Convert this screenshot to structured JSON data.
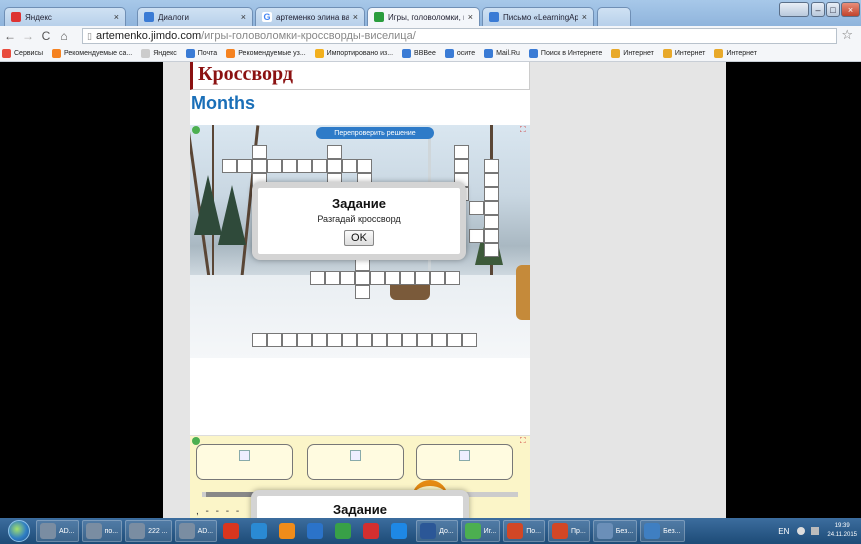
{
  "tabs": [
    {
      "label": "Яндекс",
      "icon": "yandex-icon",
      "color": "#d33"
    },
    {
      "label": "Диалоги",
      "icon": "dialogs-icon",
      "color": "#3a7bd5"
    },
    {
      "label": "артеменко элина валенти",
      "icon": "google-icon",
      "color": "#4285f4"
    },
    {
      "label": "Игры, головоломки, крос",
      "icon": "jimdo-icon",
      "color": "#2a9d3d"
    },
    {
      "label": "Письмо «LearningApps.o",
      "icon": "mail-icon",
      "color": "#3a7bd5"
    }
  ],
  "address": {
    "host": "artemenko.jimdo.com",
    "path": "/игры-головоломки-кроссворды-виселица/"
  },
  "bookmarks": [
    {
      "label": "Сервисы",
      "color": "#e84c3d"
    },
    {
      "label": "Рекомендуемые са...",
      "color": "#f58220"
    },
    {
      "label": "Яндекс",
      "color": "#cccccc"
    },
    {
      "label": "Почта",
      "color": "#3a7bd5"
    },
    {
      "label": "Рекомендуемые уз...",
      "color": "#f58220"
    },
    {
      "label": "Импортировано из...",
      "color": "#f2b01e"
    },
    {
      "label": "BBBee",
      "color": "#3a7bd5"
    },
    {
      "label": "осите",
      "color": "#3a7bd5"
    },
    {
      "label": "Mail.Ru",
      "color": "#3a7bd5"
    },
    {
      "label": "Поиск в Интернете",
      "color": "#3a7bd5"
    },
    {
      "label": "Интернет",
      "color": "#e8a92a"
    },
    {
      "label": "Интернет",
      "color": "#e8a92a"
    },
    {
      "label": "Интернет",
      "color": "#e8a92a"
    }
  ],
  "page": {
    "heading": "Кроссворд",
    "subheading": "Months"
  },
  "crossword": {
    "recheck_label": "Перепроверить решение",
    "modal_title": "Задание",
    "modal_text": "Разгадай кроссворд",
    "ok_label": "OK"
  },
  "matching": {
    "modal_title": "Задание"
  },
  "taskbar": {
    "items": [
      {
        "label": "AD...",
        "color": "#7a8da2"
      },
      {
        "label": "по...",
        "color": "#7a8da2"
      },
      {
        "label": "222 ...",
        "color": "#7a8da2"
      },
      {
        "label": "AD...",
        "color": "#7a8da2"
      },
      {
        "label": "",
        "color": "#d9361e"
      },
      {
        "label": "",
        "color": "#2a8ad4"
      },
      {
        "label": "",
        "color": "#f08c1a"
      },
      {
        "label": "",
        "color": "#2b73c9"
      },
      {
        "label": "",
        "color": "#38a047"
      },
      {
        "label": "",
        "color": "#d32f2f"
      },
      {
        "label": "",
        "color": "#1e88e5"
      },
      {
        "label": "До...",
        "color": "#2b5797"
      },
      {
        "label": "Иг...",
        "color": "#4caf50"
      },
      {
        "label": "По...",
        "color": "#d24726"
      },
      {
        "label": "Пр...",
        "color": "#d24726"
      },
      {
        "label": "Без...",
        "color": "#6b8fb8"
      },
      {
        "label": "Без...",
        "color": "#3f7fc2"
      }
    ],
    "lang": "EN",
    "time": "19:39",
    "date": "24.11.2015"
  }
}
